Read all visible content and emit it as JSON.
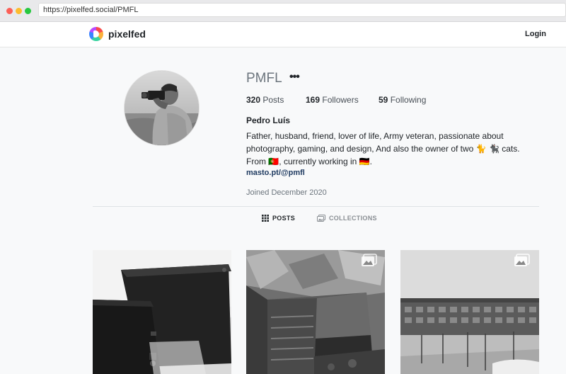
{
  "browser": {
    "url": "https://pixelfed.social/PMFL"
  },
  "nav": {
    "brand": "pixelfed",
    "login_label": "Login"
  },
  "profile": {
    "username": "PMFL",
    "more_label": "•••",
    "posts_count": "320",
    "posts_label": "Posts",
    "followers_count": "169",
    "followers_label": "Followers",
    "following_count": "59",
    "following_label": "Following",
    "display_name": "Pedro Luís",
    "bio": "Father, husband, friend, lover of life, Army veteran, passionate about photography, gaming, and design, And also the owner of two 🐈 🐈‍⬛ cats. From 🇵🇹, currently working in 🇩🇪.",
    "link": "masto.pt/@pmfl",
    "joined": "Joined December 2020"
  },
  "tabs": [
    {
      "label": "POSTS",
      "active": true,
      "icon": "grid-icon"
    },
    {
      "label": "COLLECTIONS",
      "active": false,
      "icon": "collections-icon"
    }
  ],
  "posts": [
    {
      "subject": "game-console-photo",
      "multi_image": false
    },
    {
      "subject": "stairs-photo",
      "multi_image": true
    },
    {
      "subject": "building-photo",
      "multi_image": true
    }
  ],
  "colors": {
    "accent_link": "#1e3a60",
    "window_red": "#fc5f57",
    "window_yellow": "#fdbc2e",
    "window_green": "#28c840"
  }
}
